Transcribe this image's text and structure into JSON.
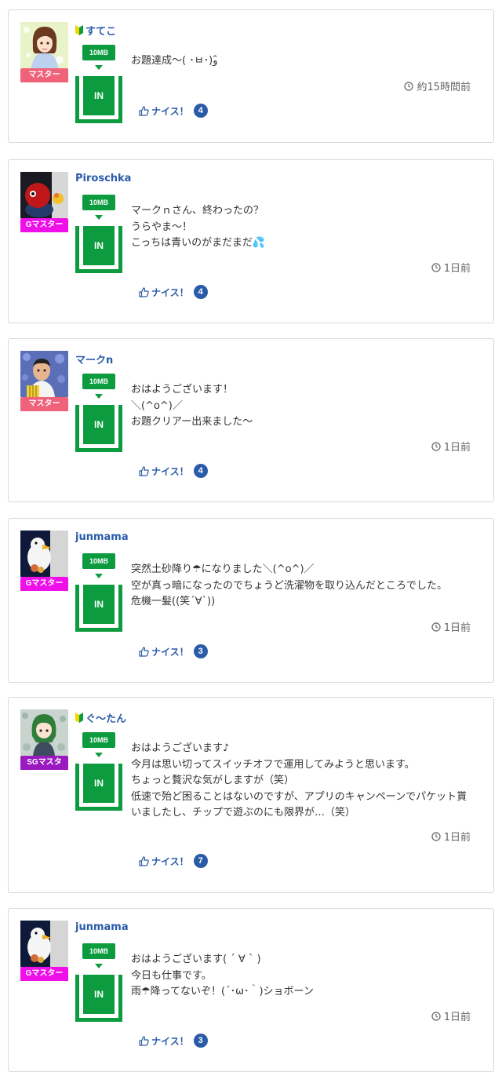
{
  "posts": [
    {
      "username": "すてこ",
      "beginner": true,
      "rank": "マスター",
      "rank_color": "#f0617a",
      "avatar_icon": "woman-portrait-icon",
      "plan": "10MB",
      "status": "IN",
      "message": "お題達成〜( ･ㅂ･)و ̑̑",
      "time": "約15時間前",
      "nice_label": "ナイス！",
      "nice_count": "4"
    },
    {
      "username": "Piroschka",
      "beginner": false,
      "rank": "Gマスター",
      "rank_color": "#ee0fe9",
      "avatar_icon": "red-figure-icon",
      "plan": "10MB",
      "status": "IN",
      "message": "マークｎさん、終わったの？\nうらやま〜！\nこっちは青いのがまだまだ💦",
      "time": "1日前",
      "nice_label": "ナイス！",
      "nice_count": "4"
    },
    {
      "username": "マークn",
      "beginner": false,
      "rank": "マスター",
      "rank_color": "#f0617a",
      "avatar_icon": "man-flowers-icon",
      "plan": "10MB",
      "status": "IN",
      "message": "おはようございます！\n＼(^o^)／\nお題クリアー出来ました〜",
      "time": "1日前",
      "nice_label": "ナイス！",
      "nice_count": "4"
    },
    {
      "username": "junmama",
      "beginner": false,
      "rank": "Gマスター",
      "rank_color": "#ee0fe9",
      "avatar_icon": "white-bird-icon",
      "plan": "10MB",
      "status": "IN",
      "message": "突然土砂降り☂になりました＼(^o^)／\n空が真っ暗になったのでちょうど洗濯物を取り込んだところでした。\n危機一髪((笑´∀`))",
      "time": "1日前",
      "nice_label": "ナイス！",
      "nice_count": "3"
    },
    {
      "username": "ぐ〜たん",
      "beginner": true,
      "rank": "SGマスタ",
      "rank_color": "#9b19c0",
      "avatar_icon": "girl-green-hair-icon",
      "plan": "10MB",
      "status": "IN",
      "message": "おはようございます♪\n今月は思い切ってスイッチオフで運用してみようと思います。\nちょっと贅沢な気がしますが（笑）\n低速で殆ど困ることはないのですが、アプリのキャンペーンでパケット貰いましたし、チップで遊ぶのにも限界が…（笑）",
      "time": "1日前",
      "nice_label": "ナイス！",
      "nice_count": "7"
    },
    {
      "username": "junmama",
      "beginner": false,
      "rank": "Gマスター",
      "rank_color": "#ee0fe9",
      "avatar_icon": "white-bird-icon",
      "plan": "10MB",
      "status": "IN",
      "message": "おはようございます(  ´ ∀ ` )\n今日も仕事です。\n雨☂降ってないぞ！(´･ω･｀)ショボーン",
      "time": "1日前",
      "nice_label": "ナイス！",
      "nice_count": "3"
    }
  ]
}
